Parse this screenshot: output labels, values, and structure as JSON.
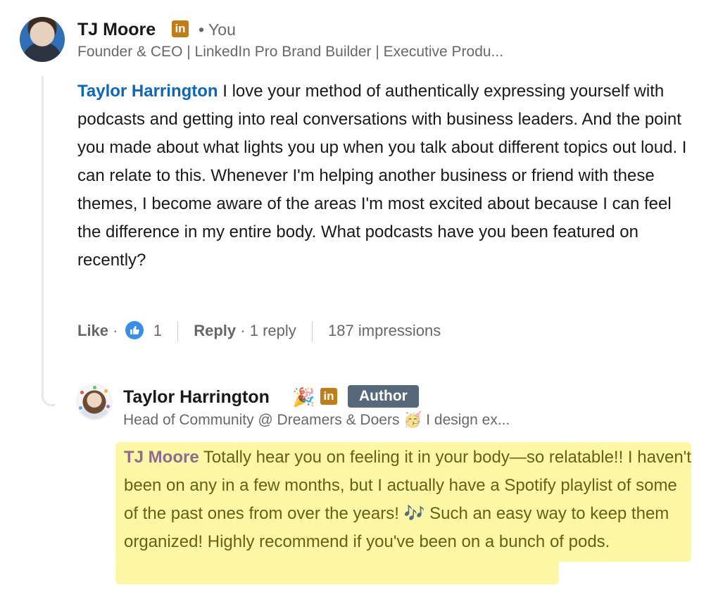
{
  "comment": {
    "author_name": "TJ Moore",
    "li_icon": "linkedin-icon",
    "separator": "•",
    "you_label": "You",
    "headline": "Founder & CEO | LinkedIn Pro Brand Builder | Executive Produ...",
    "mention": "Taylor Harrington",
    "text": " I love your method of authentically expressing yourself with podcasts and getting into real conversations with business leaders. And the point you made about what lights you up when you talk about different topics out loud. I can relate to this. Whenever I'm helping another business or friend with these themes, I become aware of the areas I'm most excited about because I can feel the difference in my entire body. What podcasts have you been featured on recently?"
  },
  "actions": {
    "like_label": "Like",
    "dot": "·",
    "reaction_count": "1",
    "reply_label": "Reply",
    "reply_count": "1 reply",
    "impressions": "187 impressions"
  },
  "reply": {
    "author_name": "Taylor Harrington",
    "party_emoji": "🎉",
    "badge_label": "Author",
    "headline": "Head of Community @ Dreamers & Doers 🥳 I design ex...",
    "mention": "TJ Moore",
    "text": " Totally hear you on feeling it in your body—so relatable!! I haven't been on any in a few months, but I actually have a Spotify playlist of some of the past ones from over the years! 🎶 Such an easy way to keep them organized! Highly recommend if you've been on a bunch of pods."
  },
  "colors": {
    "mention_blue": "#0a66c2",
    "linkedin_gold": "#c37d16",
    "author_badge": "#56687a",
    "highlight_yellow": "#fcf8a5"
  }
}
